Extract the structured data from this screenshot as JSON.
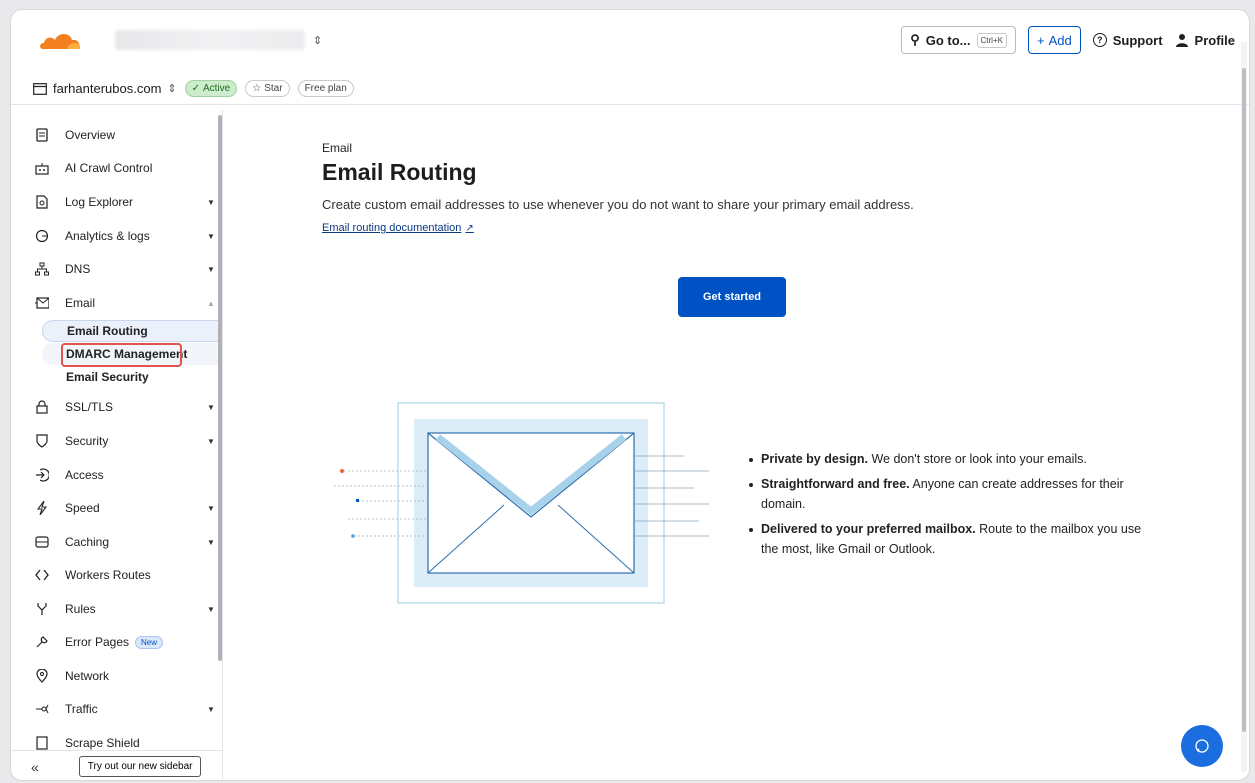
{
  "topbar": {
    "account_select_icon": "chevron-up-down-icon",
    "goto_label": "Go to...",
    "goto_shortcut": "Ctrl+K",
    "add_label": "Add",
    "support_label": "Support",
    "profile_label": "Profile"
  },
  "zone": {
    "name": "farhanterubos.com",
    "status": "Active",
    "star": "Star",
    "plan": "Free plan"
  },
  "sidebar": {
    "items": [
      {
        "label": "Overview",
        "icon": "document-icon"
      },
      {
        "label": "AI Crawl Control",
        "icon": "robot-icon"
      },
      {
        "label": "Log Explorer",
        "icon": "file-search-icon"
      },
      {
        "label": "Analytics & logs",
        "icon": "chart-icon"
      },
      {
        "label": "DNS",
        "icon": "network-icon"
      },
      {
        "label": "Email",
        "icon": "envelope-icon"
      },
      {
        "label": "SSL/TLS",
        "icon": "lock-icon"
      },
      {
        "label": "Security",
        "icon": "shield-icon"
      },
      {
        "label": "Access",
        "icon": "login-icon"
      },
      {
        "label": "Speed",
        "icon": "bolt-icon"
      },
      {
        "label": "Caching",
        "icon": "storage-icon"
      },
      {
        "label": "Workers Routes",
        "icon": "code-icon"
      },
      {
        "label": "Rules",
        "icon": "fork-icon"
      },
      {
        "label": "Error Pages",
        "icon": "wrench-icon",
        "badge": "New"
      },
      {
        "label": "Network",
        "icon": "location-icon"
      },
      {
        "label": "Traffic",
        "icon": "traffic-icon"
      },
      {
        "label": "Scrape Shield",
        "icon": "shield-doc-icon"
      }
    ],
    "email_sub": [
      "Email Routing",
      "DMARC Management",
      "Email Security"
    ],
    "footer_button": "Try out our new sidebar"
  },
  "main": {
    "breadcrumb": "Email",
    "title": "Email Routing",
    "description": "Create custom email addresses to use whenever you do not want to share your primary email address.",
    "doc_link": "Email routing documentation",
    "cta": "Get started",
    "bullets": [
      {
        "bold": "Private by design.",
        "text": " We don't store or look into your emails."
      },
      {
        "bold": "Straightforward and free.",
        "text": " Anyone can create addresses for their domain."
      },
      {
        "bold": "Delivered to your preferred mailbox.",
        "text": " Route to the mailbox you use the most, like Gmail or Outlook."
      }
    ]
  },
  "colors": {
    "accent": "#0051c3",
    "brand_orange": "#f38020",
    "highlight": "#e0534f"
  }
}
